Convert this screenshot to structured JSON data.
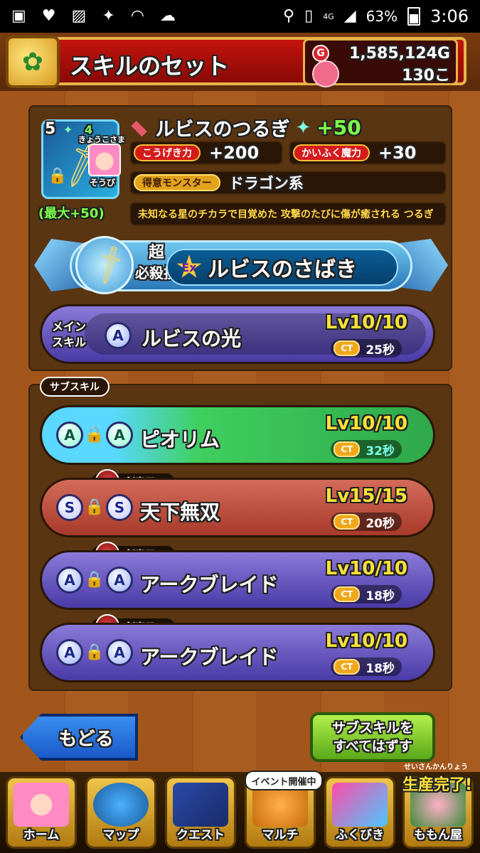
{
  "status_bar": {
    "time": "3:06",
    "battery": "63%",
    "network": "4G",
    "icons": [
      "contacts-icon",
      "heart-icon",
      "image-icon",
      "twitter-icon",
      "wifi-icon",
      "cloud-icon",
      "location-icon",
      "vibrate-icon",
      "signal-icon",
      "battery-icon"
    ]
  },
  "header": {
    "title": "スキルのセット",
    "gold": "1,585,124G",
    "gems": "130こ",
    "gold_icon": "G"
  },
  "weapon": {
    "level": "5",
    "rank": "4",
    "equipper_name": "きょうこさま",
    "equip_tag": "そうび",
    "max_plus": "(最大+50)",
    "name": "ルビスのつるぎ",
    "plus": "+50",
    "stats": [
      {
        "label": "こうげき力",
        "value": "+200"
      },
      {
        "label": "かいふく魔力",
        "value": "+30"
      }
    ],
    "specialty_label": "得意モンスター",
    "specialty_value": "ドラゴン系",
    "description": "未知なる星のチカラで目覚めた 攻撃のたびに傷が癒される つるぎ"
  },
  "ultimate": {
    "label_line1": "超",
    "label_line2": "必殺技",
    "badge": "Ex",
    "name": "ルビスのさばき"
  },
  "main_skill": {
    "tag_line1": "メイン",
    "tag_line2": "スキル",
    "gem": "A",
    "name": "ルビスの光",
    "level": "Lv10/10",
    "ct_label": "CT",
    "ct": "25秒"
  },
  "sub_skill_tab": "サブスキル",
  "sub_skills": [
    {
      "gem1": "A",
      "gem2": "A",
      "name": "ピオリム",
      "level": "Lv10/10",
      "ct_label": "CT",
      "ct": "32秒",
      "restriction": ""
    },
    {
      "gem1": "S",
      "gem2": "S",
      "name": "天下無双",
      "level": "Lv15/15",
      "ct_label": "CT",
      "ct": "20秒",
      "restriction": "剣専用"
    },
    {
      "gem1": "A",
      "gem2": "A",
      "name": "アークブレイド",
      "level": "Lv10/10",
      "ct_label": "CT",
      "ct": "18秒",
      "restriction": "剣専用"
    },
    {
      "gem1": "A",
      "gem2": "A",
      "name": "アークブレイド",
      "level": "Lv10/10",
      "ct_label": "CT",
      "ct": "18秒",
      "restriction": "剣専用"
    }
  ],
  "actions": {
    "back": "もどる",
    "remove_line1": "サブスキルを",
    "remove_line2": "すべてはずす"
  },
  "nav": {
    "items": [
      "ホーム",
      "マップ",
      "クエスト",
      "マルチ",
      "ふくびき",
      "ももん屋"
    ],
    "event_tag": "イベント開催中",
    "production_small": "せいさんかんりょう",
    "production_done": "生産完了!"
  },
  "colors": {
    "header_red": "#c3140d",
    "accent_yellow": "#ffe23a",
    "plus_green": "#7dff4a"
  }
}
